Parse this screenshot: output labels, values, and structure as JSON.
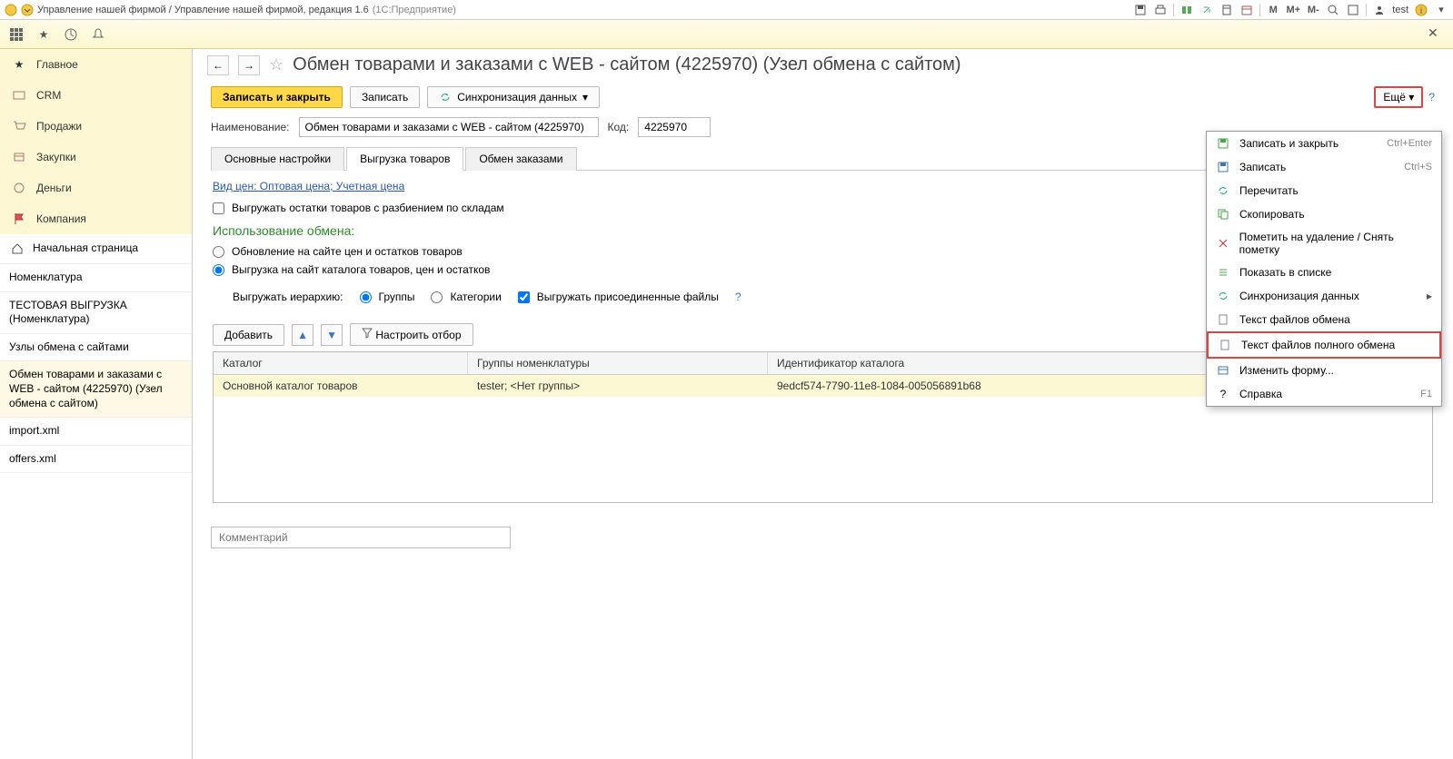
{
  "titlebar": {
    "app": "Управление нашей фирмой / Управление нашей фирмой, редакция 1.6",
    "mode": "(1С:Предприятие)",
    "user": "test",
    "m": "M",
    "mplus": "M+",
    "mminus": "M-"
  },
  "sidebar": {
    "menu": [
      {
        "id": "main",
        "label": "Главное"
      },
      {
        "id": "crm",
        "label": "CRM"
      },
      {
        "id": "sales",
        "label": "Продажи"
      },
      {
        "id": "purchases",
        "label": "Закупки"
      },
      {
        "id": "money",
        "label": "Деньги"
      },
      {
        "id": "company",
        "label": "Компания"
      }
    ],
    "nav": {
      "home": "Начальная страница",
      "items": [
        "Номенклатура",
        "ТЕСТОВАЯ ВЫГРУЗКА (Номенклатура)",
        "Узлы обмена с сайтами",
        "Обмен товарами и заказами с WEB - сайтом (4225970) (Узел обмена с сайтом)",
        "import.xml",
        "offers.xml"
      ]
    }
  },
  "page": {
    "title": "Обмен товарами и заказами с WEB - сайтом (4225970) (Узел обмена с сайтом)",
    "toolbar": {
      "save_close": "Записать и закрыть",
      "save": "Записать",
      "sync": "Синхронизация данных",
      "more": "Ещё"
    },
    "fields": {
      "name_label": "Наименование:",
      "name_value": "Обмен товарами и заказами с WEB - сайтом (4225970)",
      "code_label": "Код:",
      "code_value": "4225970"
    },
    "tabs": [
      "Основные настройки",
      "Выгрузка товаров",
      "Обмен заказами"
    ],
    "content": {
      "price_link": "Вид цен: Оптовая цена; Учетная цена",
      "unload_stock": "Выгружать остатки товаров с разбиением по складам",
      "section": "Использование обмена:",
      "radio1": "Обновление на сайте цен и остатков товаров",
      "radio2": "Выгрузка на сайт каталога товаров, цен и остатков",
      "hierarchy_label": "Выгружать иерархию:",
      "hierarchy_groups": "Группы",
      "hierarchy_categories": "Категории",
      "attach_files": "Выгружать присоединенные файлы",
      "help": "?"
    },
    "table_toolbar": {
      "add": "Добавить",
      "filter": "Настроить отбор"
    },
    "table": {
      "headers": [
        "Каталог",
        "Группы номенклатуры",
        "Идентификатор каталога"
      ],
      "rows": [
        {
          "catalog": "Основной каталог товаров",
          "groups": "tester; <Нет группы>",
          "id": "9edcf574-7790-11e8-1084-005056891b68"
        }
      ]
    },
    "comment_placeholder": "Комментарий"
  },
  "dropdown": {
    "items": [
      {
        "icon": "disk",
        "label": "Записать и закрыть",
        "shortcut": "Ctrl+Enter"
      },
      {
        "icon": "disk",
        "label": "Записать",
        "shortcut": "Ctrl+S"
      },
      {
        "icon": "refresh",
        "label": "Перечитать"
      },
      {
        "icon": "copy",
        "label": "Скопировать"
      },
      {
        "icon": "delete",
        "label": "Пометить на удаление / Снять пометку"
      },
      {
        "icon": "list",
        "label": "Показать в списке"
      },
      {
        "icon": "sync",
        "label": "Синхронизация данных",
        "submenu": true
      },
      {
        "icon": "doc",
        "label": "Текст файлов обмена"
      },
      {
        "icon": "doc",
        "label": "Текст файлов полного обмена",
        "highlight": true
      },
      {
        "icon": "form",
        "label": "Изменить форму..."
      },
      {
        "icon": "help",
        "label": "Справка",
        "shortcut": "F1"
      }
    ]
  }
}
